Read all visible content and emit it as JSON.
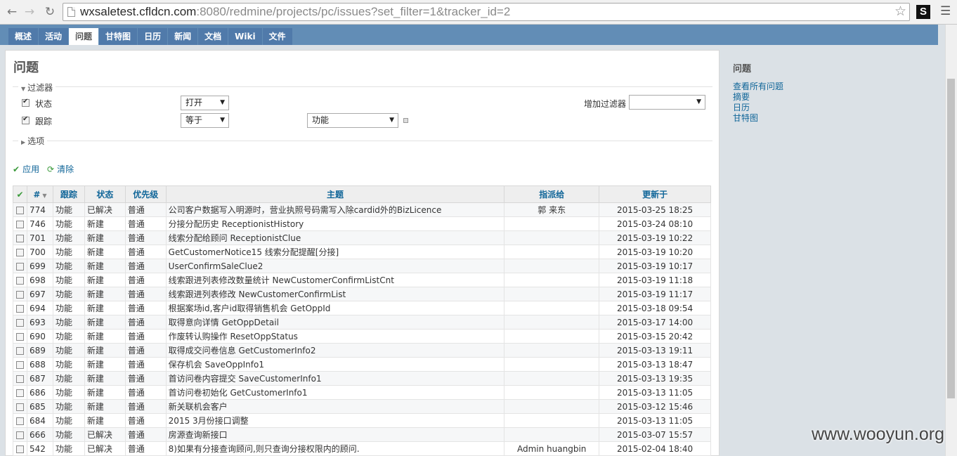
{
  "browser": {
    "url_host": "wxsaletest.cfldcn.com",
    "url_rest": ":8080/redmine/projects/pc/issues?set_filter=1&tracker_id=2",
    "ext_label": "S"
  },
  "tabs": [
    {
      "label": "概述"
    },
    {
      "label": "活动"
    },
    {
      "label": "问题"
    },
    {
      "label": "甘特图"
    },
    {
      "label": "日历"
    },
    {
      "label": "新闻"
    },
    {
      "label": "文档"
    },
    {
      "label": "Wiki"
    },
    {
      "label": "文件"
    }
  ],
  "page": {
    "title": "问题",
    "filters_legend": "过滤器",
    "options_legend": "选项",
    "filter_status_label": "状态",
    "filter_status_value": "打开",
    "filter_tracker_label": "跟踪",
    "filter_tracker_op": "等于",
    "filter_tracker_value": "功能",
    "add_filter_label": "增加过滤器",
    "apply_label": "应用",
    "clear_label": "清除"
  },
  "table": {
    "headers": [
      "#",
      "跟踪",
      "状态",
      "优先级",
      "主题",
      "指派给",
      "更新于"
    ],
    "rows": [
      {
        "id": "774",
        "tracker": "功能",
        "status": "已解决",
        "priority": "普通",
        "subject": "公司客户数据写入明源时，营业执照号码需写入除cardid外的BizLicence",
        "assignee": "郭 来东",
        "updated": "2015-03-25 18:25"
      },
      {
        "id": "746",
        "tracker": "功能",
        "status": "新建",
        "priority": "普通",
        "subject": "分接分配历史 ReceptionistHistory",
        "assignee": "",
        "updated": "2015-03-24 08:10"
      },
      {
        "id": "701",
        "tracker": "功能",
        "status": "新建",
        "priority": "普通",
        "subject": "线索分配给顾问 ReceptionistClue",
        "assignee": "",
        "updated": "2015-03-19 10:22"
      },
      {
        "id": "700",
        "tracker": "功能",
        "status": "新建",
        "priority": "普通",
        "subject": "GetCustomerNotice15 线索分配提醒[分接]",
        "assignee": "",
        "updated": "2015-03-19 10:20"
      },
      {
        "id": "699",
        "tracker": "功能",
        "status": "新建",
        "priority": "普通",
        "subject": "UserConfirmSaleClue2",
        "assignee": "",
        "updated": "2015-03-19 10:17"
      },
      {
        "id": "698",
        "tracker": "功能",
        "status": "新建",
        "priority": "普通",
        "subject": "线索跟进列表修改数量统计 NewCustomerConfirmListCnt",
        "assignee": "",
        "updated": "2015-03-19 11:18"
      },
      {
        "id": "697",
        "tracker": "功能",
        "status": "新建",
        "priority": "普通",
        "subject": "线索跟进列表修改 NewCustomerConfirmList",
        "assignee": "",
        "updated": "2015-03-19 11:17"
      },
      {
        "id": "694",
        "tracker": "功能",
        "status": "新建",
        "priority": "普通",
        "subject": "根据案场id,客户id取得销售机会 GetOppId",
        "assignee": "",
        "updated": "2015-03-18 09:54"
      },
      {
        "id": "693",
        "tracker": "功能",
        "status": "新建",
        "priority": "普通",
        "subject": "取得意向详情 GetOppDetail",
        "assignee": "",
        "updated": "2015-03-17 14:00"
      },
      {
        "id": "690",
        "tracker": "功能",
        "status": "新建",
        "priority": "普通",
        "subject": "作废转认购操作 ResetOppStatus",
        "assignee": "",
        "updated": "2015-03-15 20:42"
      },
      {
        "id": "689",
        "tracker": "功能",
        "status": "新建",
        "priority": "普通",
        "subject": "取得成交问卷信息 GetCustomerInfo2",
        "assignee": "",
        "updated": "2015-03-13 19:11"
      },
      {
        "id": "688",
        "tracker": "功能",
        "status": "新建",
        "priority": "普通",
        "subject": "保存机会 SaveOppInfo1",
        "assignee": "",
        "updated": "2015-03-13 18:47"
      },
      {
        "id": "687",
        "tracker": "功能",
        "status": "新建",
        "priority": "普通",
        "subject": "首访问卷内容提交 SaveCustomerInfo1",
        "assignee": "",
        "updated": "2015-03-13 19:35"
      },
      {
        "id": "686",
        "tracker": "功能",
        "status": "新建",
        "priority": "普通",
        "subject": "首访问卷初始化 GetCustomerInfo1",
        "assignee": "",
        "updated": "2015-03-13 11:05"
      },
      {
        "id": "685",
        "tracker": "功能",
        "status": "新建",
        "priority": "普通",
        "subject": "新关联机会客户",
        "assignee": "",
        "updated": "2015-03-12 15:46"
      },
      {
        "id": "684",
        "tracker": "功能",
        "status": "新建",
        "priority": "普通",
        "subject": "2015 3月份接口调整",
        "assignee": "",
        "updated": "2015-03-13 11:05"
      },
      {
        "id": "666",
        "tracker": "功能",
        "status": "已解决",
        "priority": "普通",
        "subject": "房源查询新接口",
        "assignee": "",
        "updated": "2015-03-07 15:57"
      },
      {
        "id": "542",
        "tracker": "功能",
        "status": "已解决",
        "priority": "普通",
        "subject": "8)如果有分接查询顾问,则只查询分接权限内的顾问.",
        "assignee": "Admin huangbin",
        "updated": "2015-02-04 18:40"
      }
    ]
  },
  "sidebar": {
    "title": "问题",
    "links": [
      "查看所有问题",
      "摘要",
      "日历",
      "甘特图"
    ]
  },
  "watermark": "www.wooyun.org"
}
